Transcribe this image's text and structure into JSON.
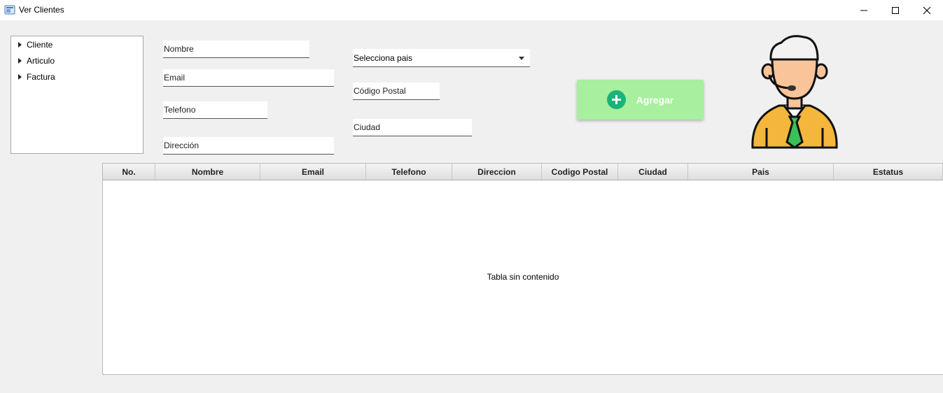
{
  "window": {
    "title": "Ver Clientes"
  },
  "tree": {
    "items": [
      "Cliente",
      "Articulo",
      "Factura"
    ]
  },
  "form": {
    "nombre": {
      "placeholder": "Nombre",
      "value": ""
    },
    "email": {
      "placeholder": "Email",
      "value": ""
    },
    "telefono": {
      "placeholder": "Telefono",
      "value": ""
    },
    "direccion": {
      "placeholder": "Dirección",
      "value": ""
    },
    "codigo_postal": {
      "placeholder": "Código Postal",
      "value": ""
    },
    "ciudad": {
      "placeholder": "Ciudad",
      "value": ""
    },
    "pais": {
      "selected": "Selecciona pais"
    }
  },
  "add_button": {
    "label": "Agregar",
    "color": "#a8ef9f",
    "icon": "plus-circle-icon"
  },
  "avatar": {
    "icon": "support-agent-icon"
  },
  "table": {
    "columns": [
      "No.",
      "Nombre",
      "Email",
      "Telefono",
      "Direccion",
      "Codigo Postal",
      "Ciudad",
      "Pais",
      "Estatus"
    ],
    "rows": [],
    "empty_message": "Tabla sin contenido"
  }
}
